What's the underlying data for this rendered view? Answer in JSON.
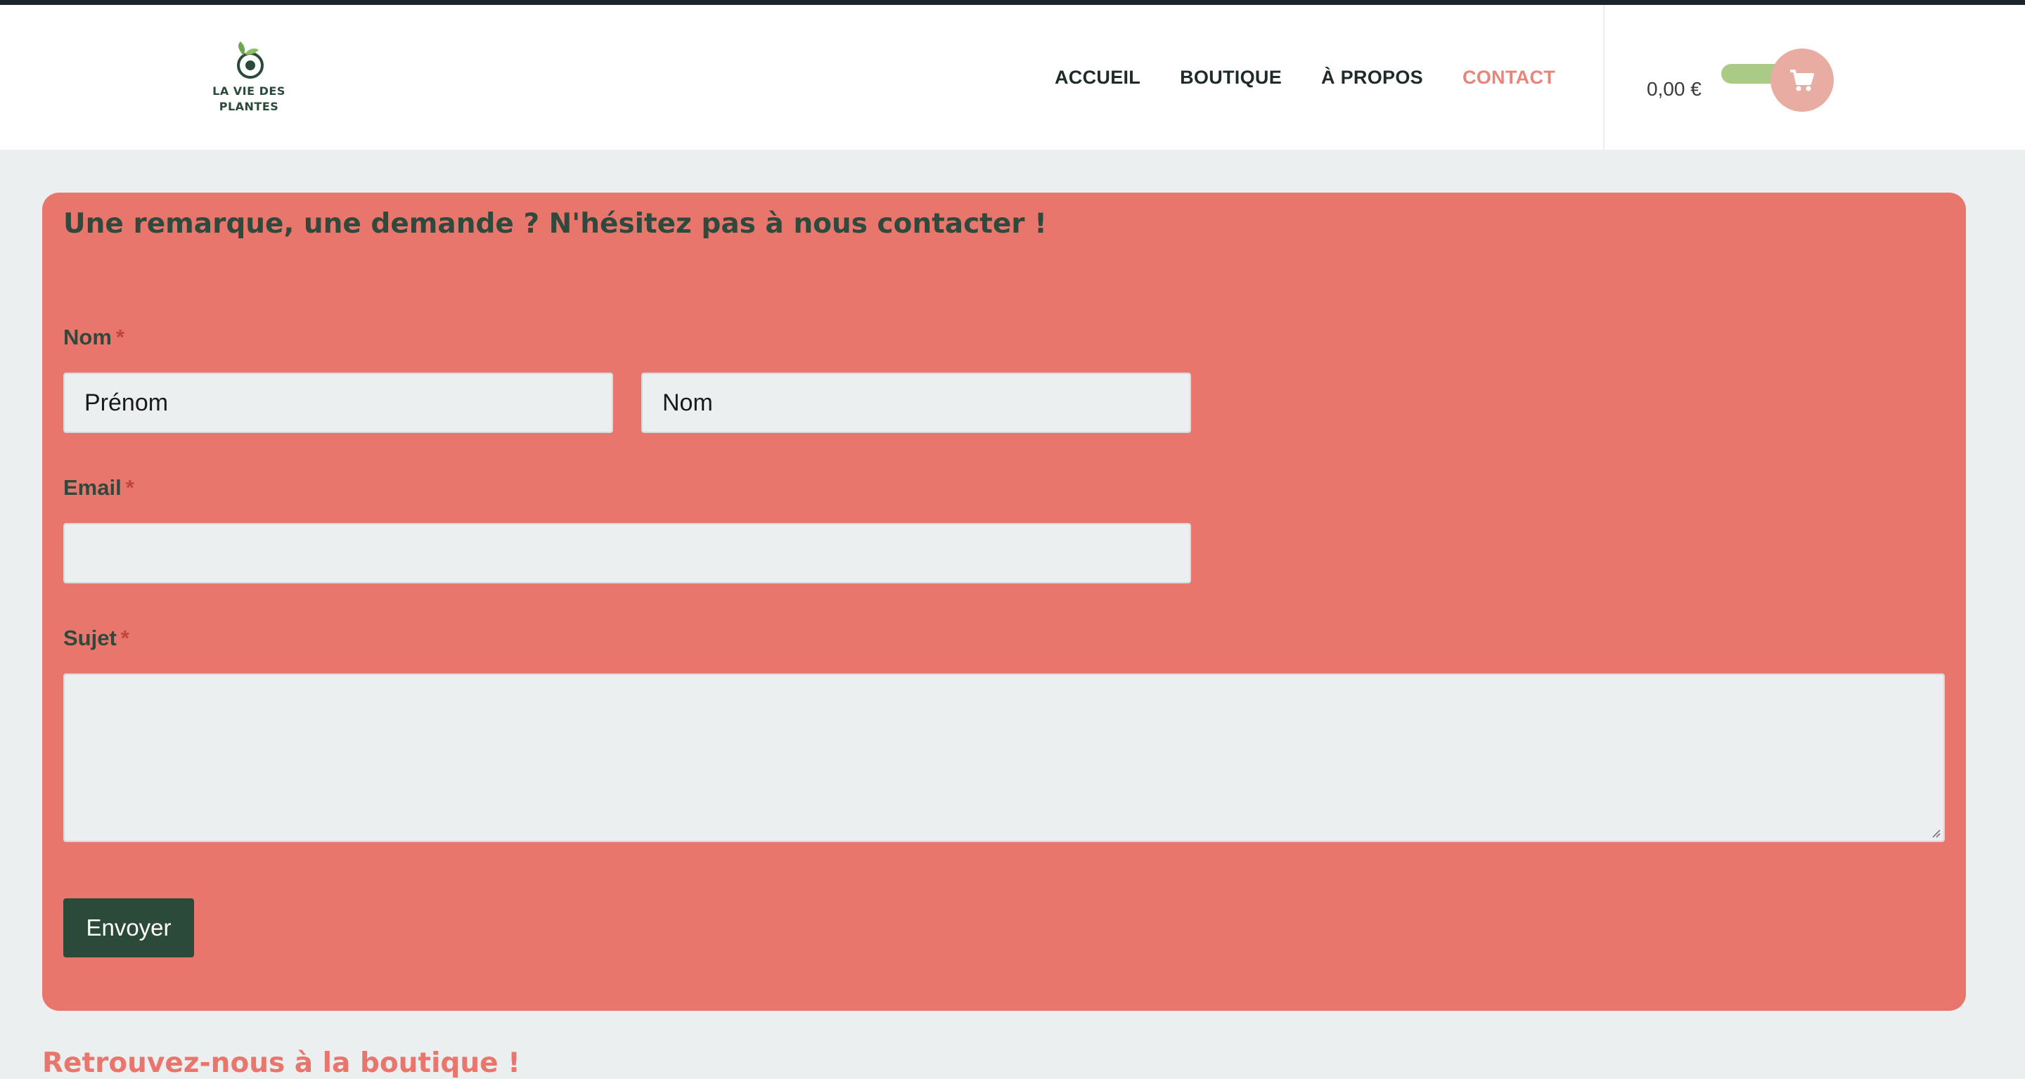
{
  "brand": {
    "logo_line1": "LA VIE DES",
    "logo_line2": "PLANTES",
    "accent_color": "#e8766d",
    "dark_green": "#2b4a3a"
  },
  "nav": {
    "items": [
      {
        "label": "ACCUEIL"
      },
      {
        "label": "BOUTIQUE"
      },
      {
        "label": "À PROPOS"
      },
      {
        "label": "CONTACT",
        "active": true
      }
    ]
  },
  "cart": {
    "total": "0,00 €",
    "icon": "cart-icon"
  },
  "form": {
    "title": "Une remarque, une demande ? N'hésitez pas à nous contacter !",
    "name_label": "Nom",
    "required_marker": "*",
    "firstname_placeholder": "Prénom",
    "lastname_placeholder": "Nom",
    "email_label": "Email",
    "email_value": "",
    "subject_label": "Sujet",
    "subject_value": "",
    "submit_label": "Envoyer"
  },
  "shop_heading": "Retrouvez-nous à la boutique !"
}
